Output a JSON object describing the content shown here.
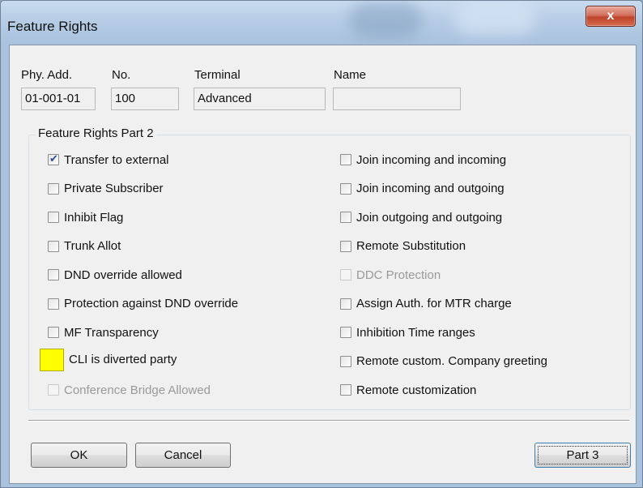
{
  "window": {
    "title": "Feature Rights",
    "close_label": "x"
  },
  "header": {
    "phy_add_label": "Phy. Add.",
    "no_label": "No.",
    "terminal_label": "Terminal",
    "name_label": "Name",
    "phy_add_value": "01-001-01",
    "no_value": "100",
    "terminal_value": "Advanced",
    "name_value": ""
  },
  "group": {
    "title": "Feature Rights Part 2",
    "left": [
      {
        "label": "Transfer to external",
        "checked": true,
        "state": "normal"
      },
      {
        "label": "Private Subscriber",
        "checked": false,
        "state": "normal"
      },
      {
        "label": "Inhibit Flag",
        "checked": false,
        "state": "normal"
      },
      {
        "label": "Trunk Allot",
        "checked": false,
        "state": "normal"
      },
      {
        "label": "DND override allowed",
        "checked": false,
        "state": "normal"
      },
      {
        "label": "Protection against DND override",
        "checked": false,
        "state": "normal"
      },
      {
        "label": "MF Transparency",
        "checked": false,
        "state": "normal"
      },
      {
        "label": "CLI is diverted party",
        "checked": false,
        "state": "highlighted"
      },
      {
        "label": "Conference Bridge Allowed",
        "checked": false,
        "state": "disabled"
      }
    ],
    "right": [
      {
        "label": "Join incoming and incoming",
        "checked": false,
        "state": "normal"
      },
      {
        "label": "Join incoming and outgoing",
        "checked": false,
        "state": "normal"
      },
      {
        "label": "Join outgoing and outgoing",
        "checked": false,
        "state": "normal"
      },
      {
        "label": "Remote Substitution",
        "checked": false,
        "state": "normal"
      },
      {
        "label": "DDC Protection",
        "checked": false,
        "state": "disabled"
      },
      {
        "label": "Assign Auth. for MTR charge",
        "checked": false,
        "state": "normal"
      },
      {
        "label": "Inhibition Time ranges",
        "checked": false,
        "state": "normal"
      },
      {
        "label": "Remote custom. Company greeting",
        "checked": false,
        "state": "normal"
      },
      {
        "label": "Remote customization",
        "checked": false,
        "state": "normal"
      }
    ]
  },
  "buttons": {
    "ok": "OK",
    "cancel": "Cancel",
    "part3": "Part 3"
  },
  "colors": {
    "highlight": "#ffff00",
    "check": "#2b4c8f",
    "close": "#c0442c"
  },
  "icons": {
    "close": "close-icon",
    "check": "checkmark-icon"
  }
}
